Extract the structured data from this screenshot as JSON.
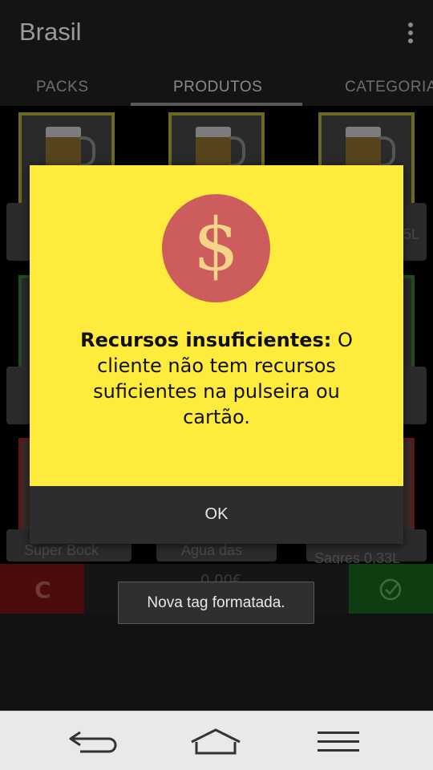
{
  "app": {
    "title": "Brasil"
  },
  "tabs": [
    {
      "label": "PACKS"
    },
    {
      "label": "PRODUTOS",
      "selected": true
    },
    {
      "label": "CATEGORIA"
    }
  ],
  "products": {
    "partial_labels": [
      "5L",
      "Super Bock",
      "Água das",
      "Sagres 0,33L"
    ]
  },
  "action_bar": {
    "clear_label": "C",
    "total": "0,00€",
    "confirm_icon": "check-circle-icon"
  },
  "dialog": {
    "icon": "dollar-icon",
    "icon_glyph": "$",
    "message_bold": "Recursos insuficientes:",
    "message_rest": " O cliente não tem recursos suficientes na pulseira ou cartão.",
    "ok_label": "OK",
    "colors": {
      "background": "#ffeb3b",
      "icon_circle": "#cd5c5c",
      "footer": "#2d2d2d"
    }
  },
  "toast": {
    "text": "Nova tag formatada."
  },
  "navbar": {
    "back_icon": "back-icon",
    "home_icon": "home-icon",
    "menu_icon": "menu-icon"
  }
}
